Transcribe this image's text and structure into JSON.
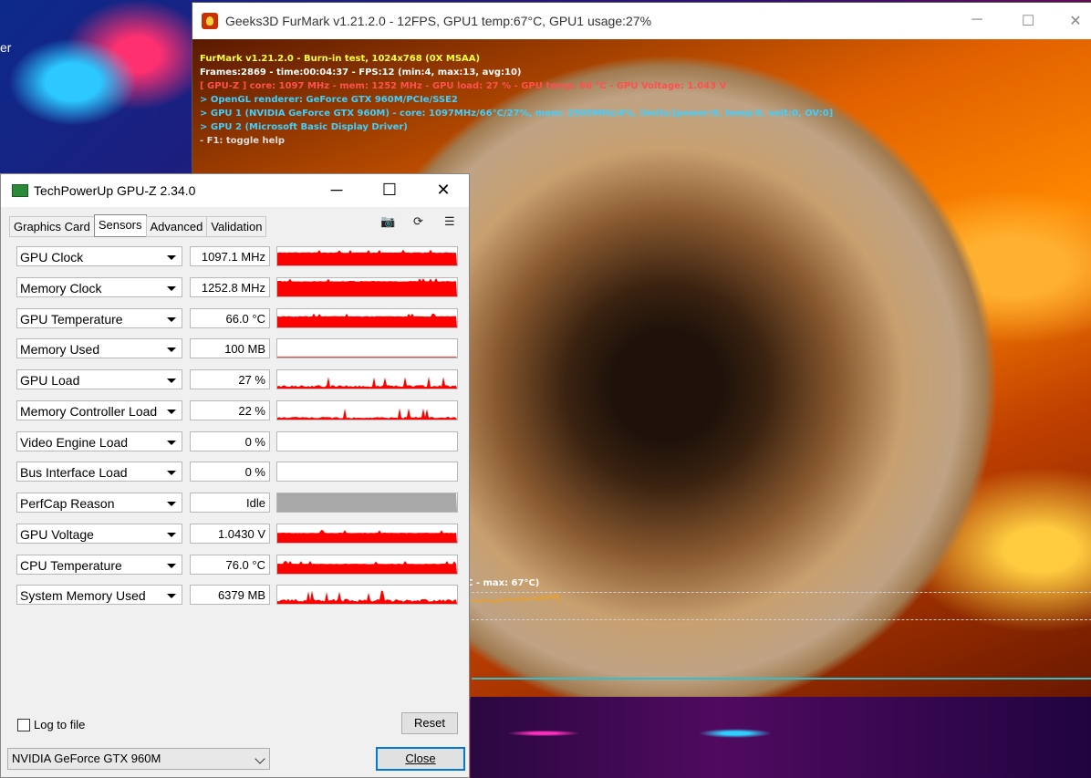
{
  "desktop": {
    "partial_label": "er"
  },
  "furmark": {
    "title": "Geeks3D FurMark v1.21.2.0 - 12FPS, GPU1 temp:67°C, GPU1 usage:27%",
    "info_lines": [
      "FurMark v1.21.2.0 - Burn-in test, 1024x768 (0X MSAA)",
      "Frames:2869 - time:00:04:37 - FPS:12 (min:4, max:13, avg:10)",
      "[ GPU-Z ] core: 1097 MHz - mem: 1252 MHz - GPU load: 27 % - GPU temp: 66 °C - GPU Voltage: 1.043 V",
      "> OpenGL renderer: GeForce GTX 960M/PCIe/SSE2",
      "> GPU 1 (NVIDIA GeForce GTX 960M) - core: 1097MHz/66°C/27%, mem: 2505MHz/4%, limits:[power:0, temp:0, volt:0, OV:0]",
      "> GPU 2 (Microsoft Basic Display Driver)",
      "- F1: toggle help"
    ],
    "temp_graph_label": "C - max: 67°C)"
  },
  "gpuz": {
    "title": "TechPowerUp GPU-Z 2.34.0",
    "tabs": [
      "Graphics Card",
      "Sensors",
      "Advanced",
      "Validation"
    ],
    "active_tab": "Sensors",
    "sensors": [
      {
        "label": "GPU Clock",
        "value": "1097.1 MHz",
        "fill": 0.72
      },
      {
        "label": "Memory Clock",
        "value": "1252.8 MHz",
        "fill": 0.85
      },
      {
        "label": "GPU Temperature",
        "value": "66.0 °C",
        "fill": 0.62
      },
      {
        "label": "Memory Used",
        "value": "100 MB",
        "fill": 0.04
      },
      {
        "label": "GPU Load",
        "value": "27 %",
        "fill": 0.27
      },
      {
        "label": "Memory Controller Load",
        "value": "22 %",
        "fill": 0.22
      },
      {
        "label": "Video Engine Load",
        "value": "0 %",
        "fill": 0
      },
      {
        "label": "Bus Interface Load",
        "value": "0 %",
        "fill": 0
      },
      {
        "label": "PerfCap Reason",
        "value": "Idle",
        "fill": 1.0
      },
      {
        "label": "GPU Voltage",
        "value": "1.0430 V",
        "fill": 0.55
      },
      {
        "label": "CPU Temperature",
        "value": "76.0 °C",
        "fill": 0.55
      },
      {
        "label": "System Memory Used",
        "value": "6379 MB",
        "fill": 0.38
      }
    ],
    "log_to_file_label": "Log to file",
    "log_to_file_checked": false,
    "reset_label": "Reset",
    "gpu_select_value": "NVIDIA GeForce GTX 960M",
    "close_label": "Close",
    "colors": {
      "graph_fill": "#ff0000",
      "perfcap_fill": "#a8a8a8"
    }
  }
}
